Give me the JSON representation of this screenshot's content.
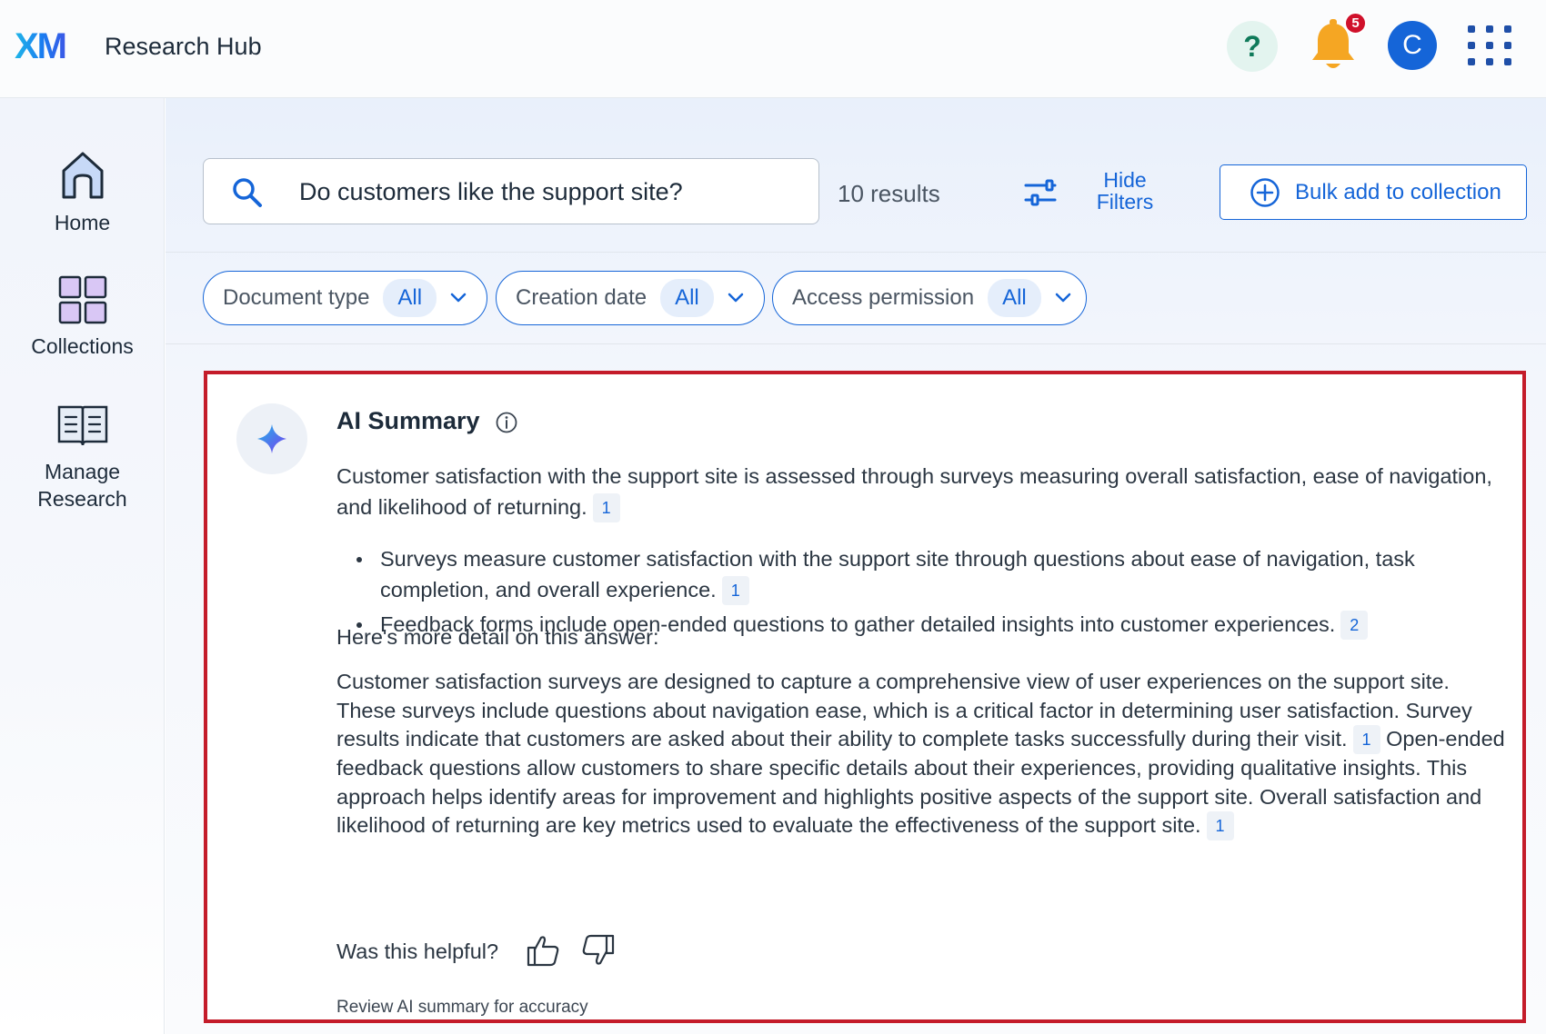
{
  "header": {
    "logo": "XM",
    "app_title": "Research Hub",
    "help_label": "?",
    "notification_count": "5",
    "avatar_initial": "C",
    "icons": [
      "help-icon",
      "bell-icon",
      "avatar",
      "apps-grid-icon"
    ]
  },
  "sidebar": {
    "items": [
      {
        "label": "Home",
        "icon": "home-icon"
      },
      {
        "label": "Collections",
        "icon": "collections-icon"
      },
      {
        "label": "Manage\nResearch",
        "label_line1": "Manage",
        "label_line2": "Research",
        "icon": "book-icon"
      }
    ]
  },
  "search": {
    "query": "Do customers like the support site?",
    "results_count": "10 results",
    "hide_filters_line1": "Hide",
    "hide_filters_line2": "Filters",
    "bulk_add_label": "Bulk add to collection"
  },
  "filters": [
    {
      "label": "Document type",
      "value": "All"
    },
    {
      "label": "Creation date",
      "value": "All"
    },
    {
      "label": "Access permission",
      "value": "All"
    }
  ],
  "summary": {
    "title": "AI Summary",
    "intro": "Customer satisfaction with the support site is assessed through surveys measuring overall satisfaction, ease of navigation, and likelihood of returning.",
    "intro_cite": "1",
    "bullets": [
      {
        "text": "Surveys measure customer satisfaction with the support site through questions about ease of navigation, task completion, and overall experience.",
        "cite": "1"
      },
      {
        "text": "Feedback forms include open-ended questions to gather detailed insights into customer experiences.",
        "cite": "2"
      }
    ],
    "more_detail_heading": "Here's more detail on this answer:",
    "detail_part1": "Customer satisfaction surveys are designed to capture a comprehensive view of user experiences on the support site. These surveys include questions about navigation ease, which is a critical factor in determining user satisfaction. Survey results indicate that customers are asked about their ability to complete tasks successfully during their visit.",
    "detail_cite1": "1",
    "detail_part2": "Open-ended feedback questions allow customers to share specific details about their experiences, providing qualitative insights. This approach helps identify areas for improvement and highlights positive aspects of the support site. Overall satisfaction and likelihood of returning are key metrics used to evaluate the effectiveness of the support site.",
    "detail_cite2": "1",
    "helpful_label": "Was this helpful?",
    "review_note": "Review AI summary for accuracy"
  },
  "colors": {
    "accent": "#1565d8",
    "highlight_border": "#c41c2a",
    "notification_badge": "#d0112b",
    "bell": "#f5a623",
    "help_bg": "#e3f4ef"
  }
}
